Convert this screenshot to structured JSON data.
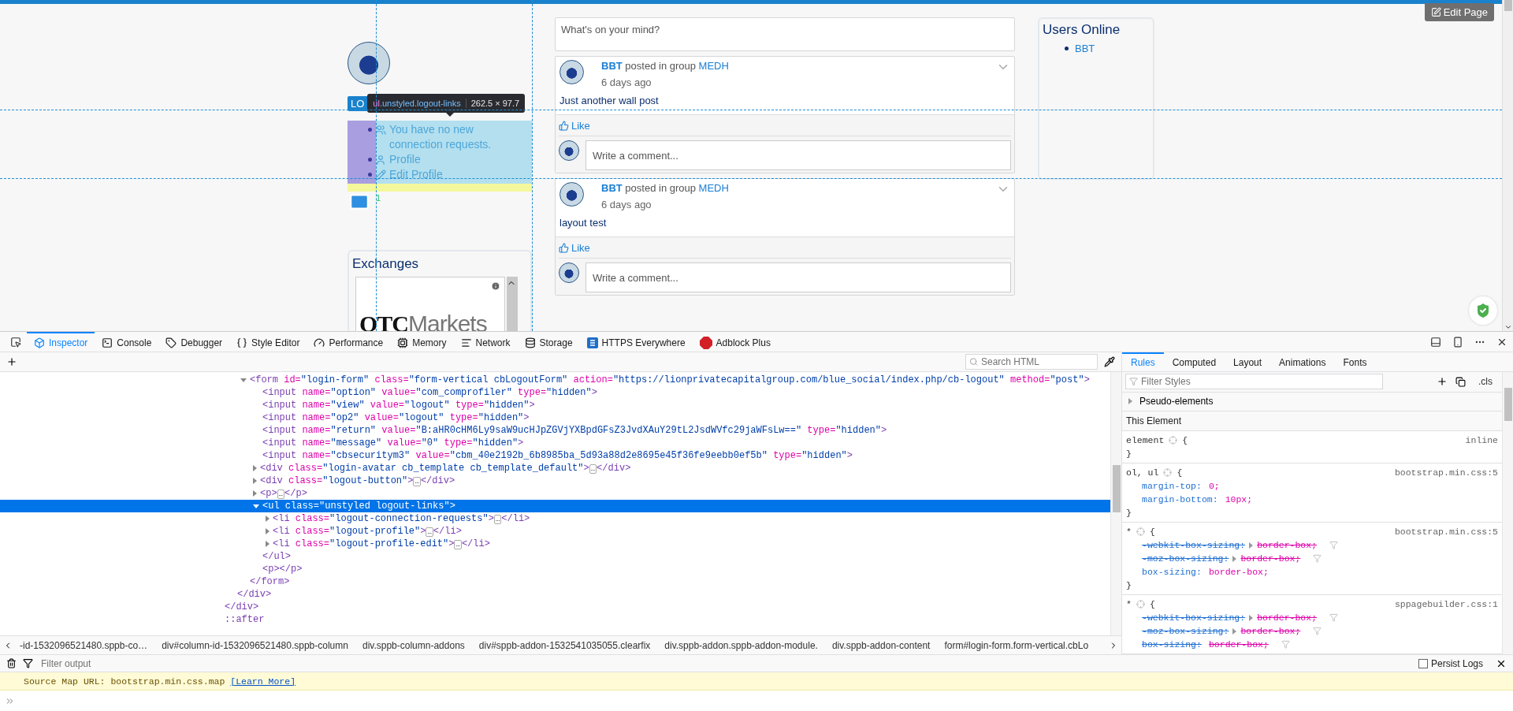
{
  "page": {
    "edit_button": "Edit Page",
    "login_button": "LO",
    "tooltip": {
      "tag": "ul",
      "selector": ".unstyled.logout-links",
      "size": "262.5 × 97.7"
    },
    "logout_links": [
      {
        "kind": "connections",
        "text": "You have no new connection requests."
      },
      {
        "kind": "profile",
        "text": "Profile"
      },
      {
        "kind": "edit",
        "text": "Edit Profile"
      }
    ],
    "mail_count": "1",
    "exchanges": {
      "title": "Exchanges",
      "logo_left": "OTC",
      "logo_right": "Markets"
    },
    "composer": {
      "placeholder": "What's on your mind?"
    },
    "posts": [
      {
        "author": "BBT",
        "action": "posted in group",
        "group": "MEDH",
        "time": "6 days ago",
        "body": "Just another wall post",
        "like": "Like",
        "comment_placeholder": "Write a comment..."
      },
      {
        "author": "BBT",
        "action": "posted in group",
        "group": "MEDH",
        "time": "6 days ago",
        "body": "layout test",
        "like": "Like",
        "comment_placeholder": "Write a comment..."
      }
    ],
    "users_online": {
      "title": "Users Online",
      "users": [
        "BBT"
      ]
    }
  },
  "devtools": {
    "tools": [
      {
        "kind": "inspector",
        "label": "Inspector",
        "selected": true
      },
      {
        "kind": "console",
        "label": "Console",
        "selected": false
      },
      {
        "kind": "debugger",
        "label": "Debugger",
        "selected": false
      },
      {
        "kind": "style",
        "label": "Style Editor",
        "selected": false
      },
      {
        "kind": "performance",
        "label": "Performance",
        "selected": false
      },
      {
        "kind": "memory",
        "label": "Memory",
        "selected": false
      },
      {
        "kind": "network",
        "label": "Network",
        "selected": false
      },
      {
        "kind": "storage",
        "label": "Storage",
        "selected": false
      },
      {
        "kind": "https",
        "label": "HTTPS Everywhere",
        "selected": false
      },
      {
        "kind": "adblock",
        "label": "Adblock Plus",
        "selected": false
      }
    ],
    "search_placeholder": "Search HTML",
    "markup": [
      {
        "closing": "</div>",
        "children": [
          {
            "closing": "</div>",
            "children": [
              {
                "text": "<form id=\"login-form\" class=\"form-vertical cbLogoutForm\" action=\"https://lionprivatecapitalgroup.com/blue_social/index.php/cb-logout\" method=\"post\">",
                "expanded": true,
                "selected": false,
                "closing": "</form>",
                "children": [
                  {
                    "text": "<input name=\"option\" value=\"com_comprofiler\" type=\"hidden\">",
                    "selected": false
                  },
                  {
                    "text": "<input name=\"view\" value=\"logout\" type=\"hidden\">",
                    "selected": false
                  },
                  {
                    "text": "<input name=\"op2\" value=\"logout\" type=\"hidden\">",
                    "selected": false
                  },
                  {
                    "text": "<input name=\"return\" value=\"B:aHR0cHM6Ly9saW9ucHJpZGVjYXBpdGFsZ3JvdXAuY29tL2JsdWVfc29jaWFsLw==\" type=\"hidden\">",
                    "selected": false
                  },
                  {
                    "text": "<input name=\"message\" value=\"0\" type=\"hidden\">",
                    "selected": false
                  },
                  {
                    "text": "<input name=\"cbsecuritym3\" value=\"cbm_40e2192b_6b8985ba_5d93a88d2e8695e45f36fe9eebb0ef5b\" type=\"hidden\">",
                    "selected": false
                  },
                  {
                    "text": "<div class=\"login-avatar cb_template cb_template_default\">…</div>",
                    "expanded": false,
                    "selected": false
                  },
                  {
                    "text": "<div class=\"logout-button\">…</div>",
                    "expanded": false,
                    "selected": false
                  },
                  {
                    "text": "<p>…</p>",
                    "expanded": false,
                    "selected": false
                  },
                  {
                    "text": "<ul class=\"unstyled logout-links\">",
                    "expanded": true,
                    "selected": true,
                    "closing": "</ul>",
                    "children": [
                      {
                        "text": "<li class=\"logout-connection-requests\">…</li>",
                        "expanded": false,
                        "selected": false
                      },
                      {
                        "text": "<li class=\"logout-profile\">…</li>",
                        "expanded": false,
                        "selected": false
                      },
                      {
                        "text": "<li class=\"logout-profile-edit\">…</li>",
                        "expanded": false,
                        "selected": false
                      }
                    ]
                  },
                  {
                    "text": "<p></p>",
                    "selected": false
                  }
                ]
              }
            ]
          }
        ]
      },
      {
        "text": "::after",
        "selected": false
      }
    ],
    "breadcrumbs": [
      "-id-1532096521480.sppb-co…",
      "div#column-id-1532096521480.sppb-column",
      "div.sppb-column-addons",
      "div#sppb-addon-1532541035055.clearfix",
      "div.sppb-addon.sppb-addon-module.",
      "div.sppb-addon-content",
      "form#login-form.form-vertical.cbLo"
    ],
    "side_tabs": [
      {
        "label": "Rules",
        "selected": true
      },
      {
        "label": "Computed",
        "selected": false
      },
      {
        "label": "Layout",
        "selected": false
      },
      {
        "label": "Animations",
        "selected": false
      },
      {
        "label": "Fonts",
        "selected": false
      }
    ],
    "filter_placeholder": "Filter Styles",
    "class_toggle": ".cls",
    "pseudo_elements": "Pseudo-elements",
    "section": "This Element",
    "rules": [
      {
        "selector": "element",
        "open": "{",
        "close": "}",
        "source": "inline"
      },
      {
        "selector": "ol, ul",
        "open": "{",
        "close": "}",
        "source": "bootstrap.min.css:5",
        "declarations": [
          {
            "property": "margin-top:",
            "value": "0;",
            "overridden": false,
            "expandable": false
          },
          {
            "property": "margin-bottom:",
            "value": "10px;",
            "overridden": false,
            "expandable": false
          }
        ]
      },
      {
        "selector": "*",
        "open": "{",
        "close": "}",
        "source": "bootstrap.min.css:5",
        "declarations": [
          {
            "property": "-webkit-box-sizing:",
            "value": "border-box;",
            "overridden": true,
            "expandable": true
          },
          {
            "property": "-moz-box-sizing:",
            "value": "border-box;",
            "overridden": true,
            "expandable": true
          },
          {
            "property": "box-sizing:",
            "value": "border-box;",
            "overridden": false,
            "expandable": false
          }
        ]
      },
      {
        "selector": "*",
        "open": "{",
        "source": "sppagebuilder.css:1",
        "declarations": [
          {
            "property": "-webkit-box-sizing:",
            "value": "border-box;",
            "overridden": true,
            "expandable": true
          },
          {
            "property": "-moz-box-sizing:",
            "value": "border-box;",
            "overridden": true,
            "expandable": true
          },
          {
            "property": "box-sizing:",
            "value": "border-box;",
            "overridden": true,
            "expandable": false
          }
        ]
      }
    ],
    "console": {
      "filter_placeholder": "Filter output",
      "persist_label": "Persist Logs",
      "persist_checked": false,
      "message": {
        "text": "Source Map URL: bootstrap.min.css.map",
        "link": "[Learn More]"
      }
    }
  }
}
